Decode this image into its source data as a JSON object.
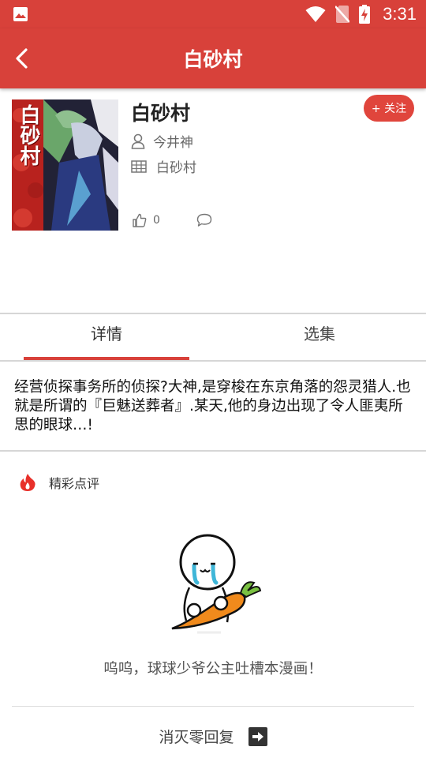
{
  "status_bar": {
    "time": "3:31"
  },
  "app_bar": {
    "title": "白砂村"
  },
  "comic": {
    "title": "白砂村",
    "author": "今井神",
    "category": "白砂村",
    "likes": "0",
    "follow_label": "+ 关注"
  },
  "tabs": [
    {
      "label": "详情"
    },
    {
      "label": "选集"
    }
  ],
  "synopsis": "经营侦探事务所的侦探?大神,是穿梭在东京角落的怨灵猎人.也就是所谓的『巨魅送葬者』.某天,他的身边出现了令人匪夷所思的眼球…!",
  "comments": {
    "section_title": "精彩点评",
    "empty_text": "呜呜，球球少爷公主吐槽本漫画！",
    "reply_label": "消灭零回复"
  },
  "cover_art": {
    "title_text": "白砂村"
  },
  "colors": {
    "brand": "#d8413a",
    "fire": "#e8302a"
  },
  "icons": [
    "image-icon",
    "wifi-icon",
    "no-sim-icon",
    "battery-icon",
    "back-arrow-icon",
    "user-icon",
    "category-icon",
    "thumbs-up-icon",
    "comment-icon",
    "fire-icon",
    "arrow-right-icon"
  ]
}
